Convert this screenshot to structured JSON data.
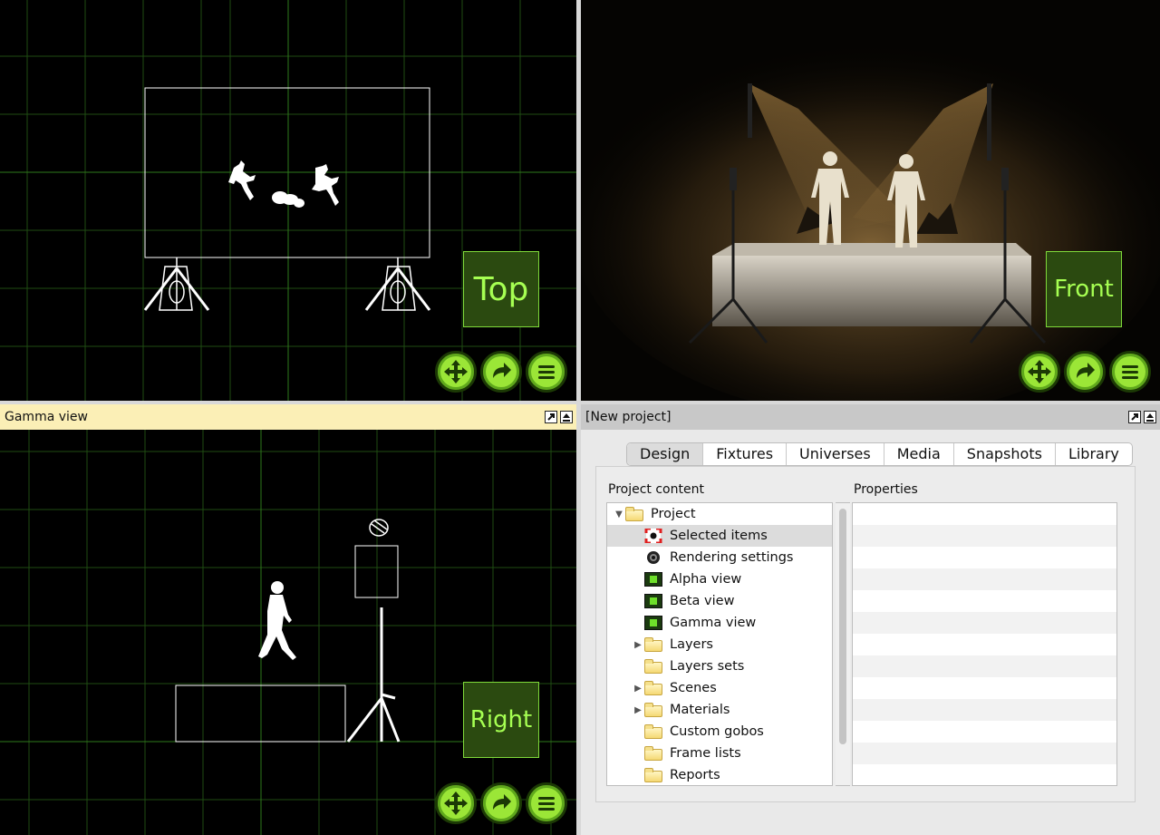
{
  "viewports": {
    "top": {
      "label": "Top"
    },
    "front": {
      "label": "Front"
    },
    "right": {
      "label": "Right"
    },
    "button_icons": [
      "move-arrows-icon",
      "rotate-arrow-icon",
      "menu-lines-icon"
    ]
  },
  "gamma_panel": {
    "title": "Gamma view"
  },
  "project_panel": {
    "title": "[New project]",
    "tabs": [
      "Design",
      "Fixtures",
      "Universes",
      "Media",
      "Snapshots",
      "Library"
    ],
    "active_tab": "Design",
    "project_content_header": "Project content",
    "properties_header": "Properties",
    "tree": [
      {
        "label": "Project",
        "icon": "folder-icon",
        "indent": 0,
        "twisty": "expanded"
      },
      {
        "label": "Selected items",
        "icon": "selection-target-icon",
        "indent": 1,
        "twisty": "none",
        "selected": true
      },
      {
        "label": "Rendering settings",
        "icon": "camera-lens-icon",
        "indent": 1,
        "twisty": "none"
      },
      {
        "label": "Alpha view",
        "icon": "viewport-icon",
        "indent": 1,
        "twisty": "none"
      },
      {
        "label": "Beta view",
        "icon": "viewport-icon",
        "indent": 1,
        "twisty": "none"
      },
      {
        "label": "Gamma view",
        "icon": "viewport-icon",
        "indent": 1,
        "twisty": "none"
      },
      {
        "label": "Layers",
        "icon": "folder-icon",
        "indent": 1,
        "twisty": "collapsed"
      },
      {
        "label": "Layers sets",
        "icon": "folder-icon",
        "indent": 1,
        "twisty": "none"
      },
      {
        "label": "Scenes",
        "icon": "folder-icon",
        "indent": 1,
        "twisty": "collapsed"
      },
      {
        "label": "Materials",
        "icon": "folder-icon",
        "indent": 1,
        "twisty": "collapsed"
      },
      {
        "label": "Custom gobos",
        "icon": "folder-icon",
        "indent": 1,
        "twisty": "none"
      },
      {
        "label": "Frame lists",
        "icon": "folder-icon",
        "indent": 1,
        "twisty": "none"
      },
      {
        "label": "Reports",
        "icon": "folder-icon",
        "indent": 1,
        "twisty": "none"
      }
    ]
  },
  "colors": {
    "grid": "#1f4d12",
    "axis": "#2e7a1c",
    "accent_green": "#9be637",
    "label_text": "#a6ff52",
    "gamma_title_bg": "#fbefb6",
    "project_title_bg": "#c8c8c8"
  }
}
